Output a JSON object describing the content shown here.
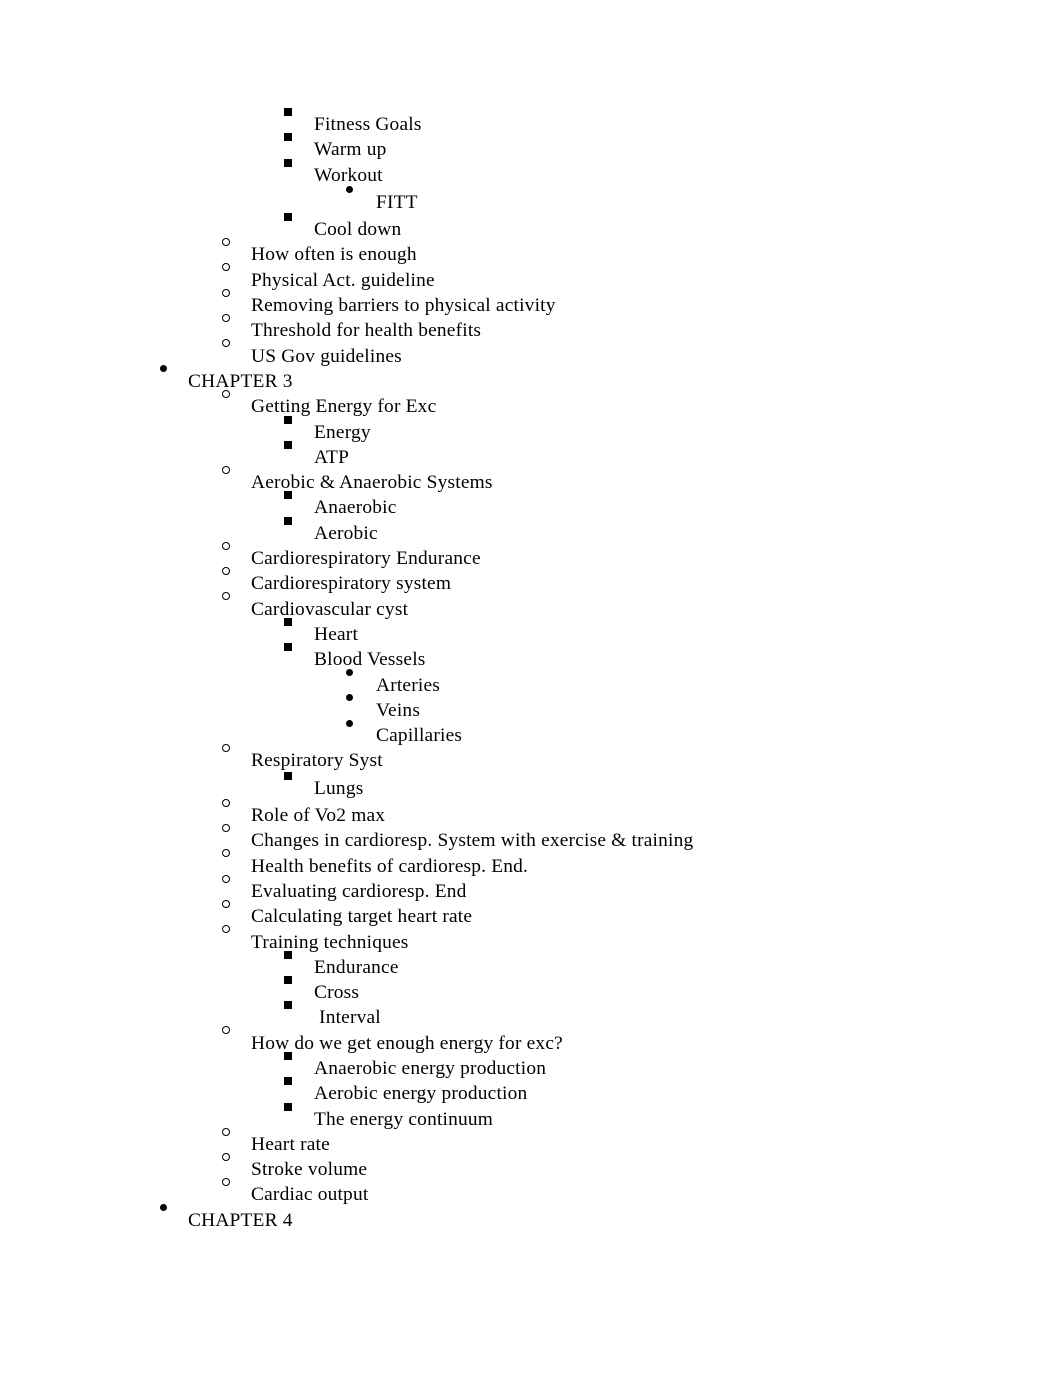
{
  "document": {
    "type": "outline-notes",
    "background_color": "#ffffff",
    "text_color": "#000000"
  },
  "outline": {
    "items": [
      {
        "level": 3,
        "marker": "square-bullet",
        "label": "Fitness Goals"
      },
      {
        "level": 3,
        "marker": "square-bullet",
        "label": "Warm up"
      },
      {
        "level": 3,
        "marker": "square-bullet",
        "label": "Workout"
      },
      {
        "level": 4,
        "marker": "round-bullet",
        "label": "FITT"
      },
      {
        "level": 3,
        "marker": "square-bullet",
        "label": "Cool down"
      },
      {
        "level": 2,
        "marker": "hollow-circle-bullet",
        "label": "How often is enough"
      },
      {
        "level": 2,
        "marker": "hollow-circle-bullet",
        "label": "Physical Act. guideline"
      },
      {
        "level": 2,
        "marker": "hollow-circle-bullet",
        "label": "Removing barriers to physical activity"
      },
      {
        "level": 2,
        "marker": "hollow-circle-bullet",
        "label": "Threshold for health benefits"
      },
      {
        "level": 2,
        "marker": "hollow-circle-bullet",
        "label": "US Gov guidelines"
      },
      {
        "level": 1,
        "marker": "round-bullet",
        "label": "CHAPTER 3"
      },
      {
        "level": 2,
        "marker": "hollow-circle-bullet",
        "label": "Getting Energy for Exc"
      },
      {
        "level": 3,
        "marker": "square-bullet",
        "label": "Energy"
      },
      {
        "level": 3,
        "marker": "square-bullet",
        "label": "ATP"
      },
      {
        "level": 2,
        "marker": "hollow-circle-bullet",
        "label": "Aerobic & Anaerobic Systems"
      },
      {
        "level": 3,
        "marker": "square-bullet",
        "label": "Anaerobic"
      },
      {
        "level": 3,
        "marker": "square-bullet",
        "label": "Aerobic"
      },
      {
        "level": 2,
        "marker": "hollow-circle-bullet",
        "label": "Cardiorespiratory Endurance"
      },
      {
        "level": 2,
        "marker": "hollow-circle-bullet",
        "label": "Cardiorespiratory system"
      },
      {
        "level": 2,
        "marker": "hollow-circle-bullet",
        "label": "Cardiovascular cyst"
      },
      {
        "level": 3,
        "marker": "square-bullet",
        "label": "Heart"
      },
      {
        "level": 3,
        "marker": "square-bullet",
        "label": "Blood Vessels"
      },
      {
        "level": 4,
        "marker": "round-bullet",
        "label": "Arteries"
      },
      {
        "level": 4,
        "marker": "round-bullet",
        "label": "Veins"
      },
      {
        "level": 4,
        "marker": "round-bullet",
        "label": "Capillaries"
      },
      {
        "level": 2,
        "marker": "hollow-circle-bullet",
        "label": "Respiratory Syst"
      },
      {
        "level": 3,
        "marker": "square-bullet",
        "label": "Lungs"
      },
      {
        "level": 2,
        "marker": "hollow-circle-bullet",
        "label": "Role of Vo2 max"
      },
      {
        "level": 2,
        "marker": "hollow-circle-bullet",
        "label": "Changes in cardioresp. System with exercise & training"
      },
      {
        "level": 2,
        "marker": "hollow-circle-bullet",
        "label": "Health benefits of cardioresp. End."
      },
      {
        "level": 2,
        "marker": "hollow-circle-bullet",
        "label": "Evaluating cardioresp. End"
      },
      {
        "level": 2,
        "marker": "hollow-circle-bullet",
        "label": "Calculating target heart rate"
      },
      {
        "level": 2,
        "marker": "hollow-circle-bullet",
        "label": "Training techniques"
      },
      {
        "level": 3,
        "marker": "square-bullet",
        "label": "Endurance"
      },
      {
        "level": 3,
        "marker": "square-bullet",
        "label": "Cross"
      },
      {
        "level": 3,
        "marker": "square-bullet",
        "label": " Interval"
      },
      {
        "level": 2,
        "marker": "hollow-circle-bullet",
        "label": "How do we get enough energy for exc?"
      },
      {
        "level": 3,
        "marker": "square-bullet",
        "label": "Anaerobic energy production"
      },
      {
        "level": 3,
        "marker": "square-bullet",
        "label": "Aerobic energy production"
      },
      {
        "level": 3,
        "marker": "square-bullet",
        "label": "The energy continuum"
      },
      {
        "level": 2,
        "marker": "hollow-circle-bullet",
        "label": "Heart rate"
      },
      {
        "level": 2,
        "marker": "hollow-circle-bullet",
        "label": "Stroke volume"
      },
      {
        "level": 2,
        "marker": "hollow-circle-bullet",
        "label": "Cardiac output"
      },
      {
        "level": 1,
        "marker": "round-bullet",
        "label": "CHAPTER 4"
      }
    ]
  }
}
